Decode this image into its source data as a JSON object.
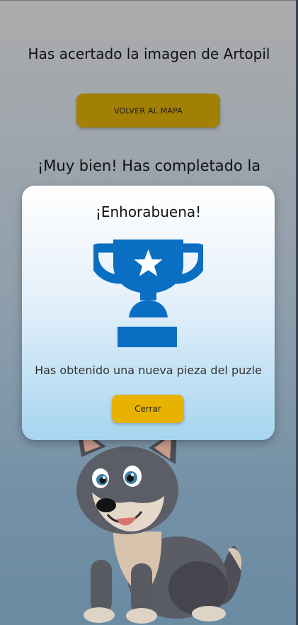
{
  "page": {
    "headline": "Has acertado la imagen de Artopil",
    "map_button_label": "VOLVER AL MAPA",
    "completed_text": "¡Muy bien! Has completado la"
  },
  "modal": {
    "title": "¡Enhorabuena!",
    "icon": "trophy-icon",
    "message": "Has obtenido una nueva pieza del puzle",
    "close_label": "Cerrar"
  },
  "illustration": {
    "subject": "wolf-cub-icon"
  },
  "colors": {
    "map_button": "#a27f05",
    "close_button": "#e8b200",
    "trophy": "#0a6fc2",
    "background_top": "#ababab",
    "background_bottom": "#6a8ba2"
  }
}
